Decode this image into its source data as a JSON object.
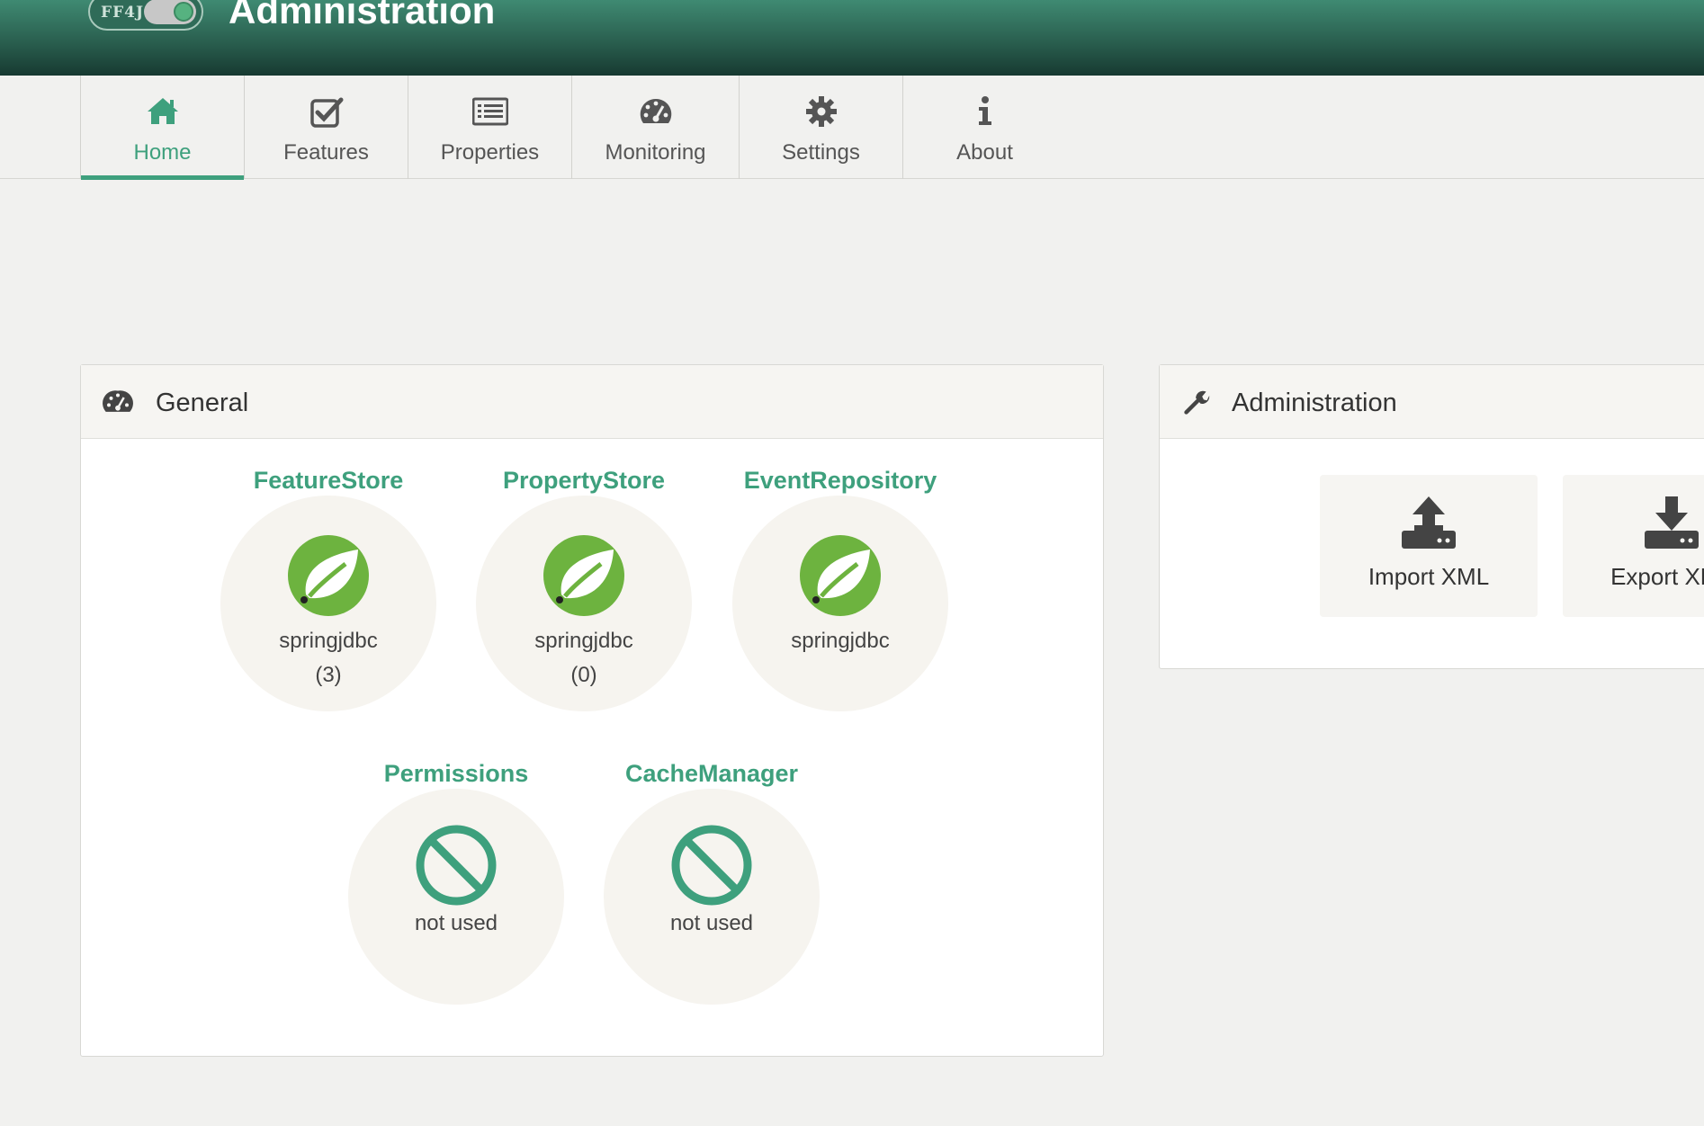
{
  "header": {
    "brand": "FF4J",
    "title": "Administration"
  },
  "nav": {
    "tabs": [
      {
        "label": "Home",
        "icon": "home-icon",
        "active": true
      },
      {
        "label": "Features",
        "icon": "check-square-icon",
        "active": false
      },
      {
        "label": "Properties",
        "icon": "list-icon",
        "active": false
      },
      {
        "label": "Monitoring",
        "icon": "dashboard-icon",
        "active": false
      },
      {
        "label": "Settings",
        "icon": "gear-icon",
        "active": false
      },
      {
        "label": "About",
        "icon": "info-icon",
        "active": false
      }
    ]
  },
  "general": {
    "title": "General",
    "stores": [
      {
        "title": "FeatureStore",
        "name": "springjdbc",
        "count": "(3)",
        "icon": "spring-leaf-icon"
      },
      {
        "title": "PropertyStore",
        "name": "springjdbc",
        "count": "(0)",
        "icon": "spring-leaf-icon"
      },
      {
        "title": "EventRepository",
        "name": "springjdbc",
        "count": "",
        "icon": "spring-leaf-icon"
      },
      {
        "title": "Permissions",
        "name": "not used",
        "count": "",
        "icon": "ban-icon"
      },
      {
        "title": "CacheManager",
        "name": "not used",
        "count": "",
        "icon": "ban-icon"
      }
    ]
  },
  "administration": {
    "title": "Administration",
    "actions": [
      {
        "label": "Import XML",
        "icon": "upload-icon"
      },
      {
        "label": "Export XML",
        "icon": "download-icon"
      }
    ]
  },
  "colors": {
    "accent": "#3ea07d",
    "header_dark": "#173a31",
    "spring_green": "#6db33f"
  }
}
